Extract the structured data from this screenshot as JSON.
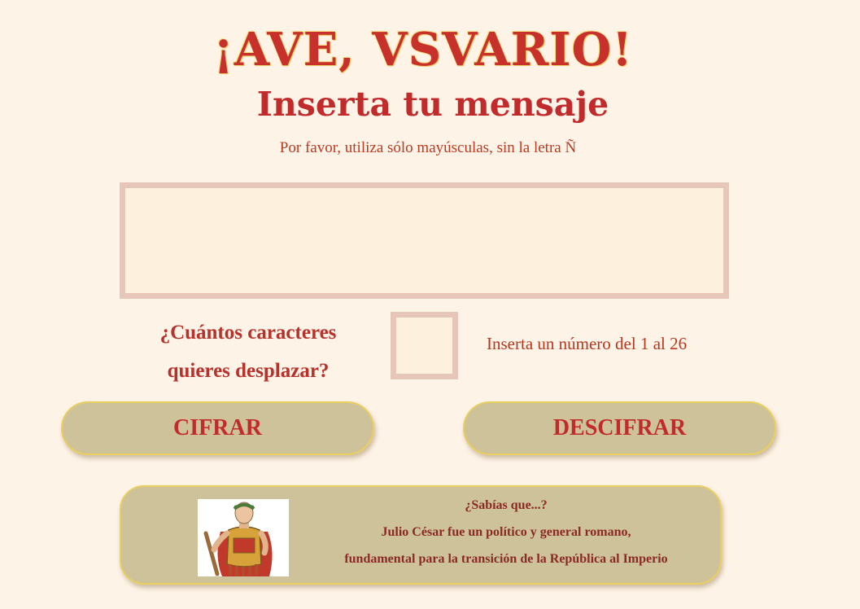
{
  "header": {
    "title": "¡AVE, VSVARIO!",
    "subtitle": "Inserta tu mensaje",
    "hint": "Por favor, utiliza sólo mayúsculas, sin la letra Ñ"
  },
  "message": {
    "value": "",
    "placeholder": ""
  },
  "shift": {
    "question_line1": "¿Cuántos caracteres",
    "question_line2": "quieres desplazar?",
    "value": "",
    "hint": "Inserta un número del 1 al 26"
  },
  "buttons": {
    "encrypt": "CIFRAR",
    "decrypt": "DESCIFRAR"
  },
  "fact": {
    "heading": "¿Sabías que...?",
    "line1": "Julio César fue un político y general romano,",
    "line2": "fundamental para la transición de la República al Imperio",
    "image_icon": "julius-caesar-portrait"
  },
  "colors": {
    "background": "#fdf3e7",
    "title_red": "#c8302b",
    "button_bg": "#cec29a",
    "button_border": "#e9cf5f",
    "field_border": "#e6c6b8"
  }
}
